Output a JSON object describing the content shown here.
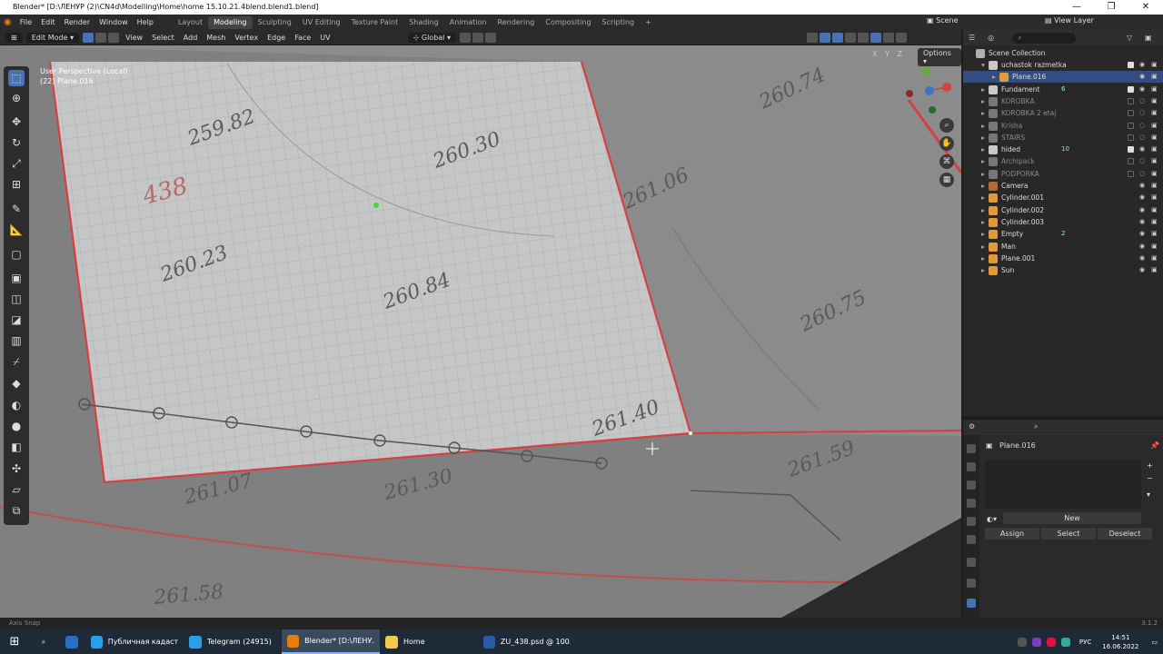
{
  "window": {
    "title": "Blender* [D:\\ЛЕНУР (2)\\CN4d\\Modelling\\Home\\home 15.10.21.4blend.blend1.blend]"
  },
  "menu": {
    "items": [
      "File",
      "Edit",
      "Render",
      "Window",
      "Help"
    ],
    "workspaces": [
      "Layout",
      "Modeling",
      "Sculpting",
      "UV Editing",
      "Texture Paint",
      "Shading",
      "Animation",
      "Rendering",
      "Compositing",
      "Scripting"
    ],
    "active_workspace": "Modeling",
    "add": "+",
    "scene": "Scene",
    "view_layer": "View Layer"
  },
  "header": {
    "mode": "Edit Mode",
    "items": [
      "View",
      "Select",
      "Add",
      "Mesh",
      "Vertex",
      "Edge",
      "Face",
      "UV"
    ],
    "orientation": "Global"
  },
  "viewport": {
    "view_name": "User Perspective (Local)",
    "object_info": "(22) Plane.016",
    "options": "Options",
    "axes": "X Y Z",
    "annotations": [
      "259.82",
      "260.30",
      "438",
      "261.06",
      "260.74",
      "260.23",
      "260.84",
      "260.75",
      "261.40",
      "261.59",
      "261.07",
      "261.30",
      "261.58"
    ]
  },
  "outliner": {
    "title": "Scene Collection",
    "search_placeholder": "",
    "rows": [
      {
        "label": "uchastok razmetka",
        "indent": 1,
        "expanded": true,
        "type": "collection",
        "check": true
      },
      {
        "label": "Plane.016",
        "indent": 2,
        "type": "mesh",
        "selected": true
      },
      {
        "label": "Fundament",
        "indent": 1,
        "type": "collection",
        "check": true,
        "extra": "6"
      },
      {
        "label": "KOROBKA",
        "indent": 1,
        "type": "collection",
        "dim": true
      },
      {
        "label": "KOROBKA 2 etaj",
        "indent": 1,
        "type": "collection",
        "dim": true
      },
      {
        "label": "Krisha",
        "indent": 1,
        "type": "collection",
        "dim": true
      },
      {
        "label": "STAIRS",
        "indent": 1,
        "type": "collection",
        "dim": true
      },
      {
        "label": "hided",
        "indent": 1,
        "type": "collection",
        "check": true,
        "extra": "10"
      },
      {
        "label": "Archipack",
        "indent": 1,
        "type": "collection",
        "dim": true
      },
      {
        "label": "PODPORKA",
        "indent": 1,
        "type": "collection",
        "dim": true
      },
      {
        "label": "Camera",
        "indent": 1,
        "type": "camera"
      },
      {
        "label": "Cylinder.001",
        "indent": 1,
        "type": "mesh"
      },
      {
        "label": "Cylinder.002",
        "indent": 1,
        "type": "mesh"
      },
      {
        "label": "Cylinder.003",
        "indent": 1,
        "type": "mesh"
      },
      {
        "label": "Empty",
        "indent": 1,
        "type": "empty",
        "extra": "2"
      },
      {
        "label": "Man",
        "indent": 1,
        "type": "mesh"
      },
      {
        "label": "Plane.001",
        "indent": 1,
        "type": "mesh"
      },
      {
        "label": "Sun",
        "indent": 1,
        "type": "light"
      }
    ]
  },
  "properties": {
    "object": "Plane.016",
    "new": "New",
    "assign": "Assign",
    "select": "Select",
    "deselect": "Deselect"
  },
  "status": {
    "hint": "Axis Snap",
    "version": "3.1.2"
  },
  "taskbar": {
    "apps": [
      {
        "label": "Публичная кадаст...",
        "color": "#2aa1e6"
      },
      {
        "label": "Telegram (24915)",
        "color": "#2aa1e6"
      },
      {
        "label": "Blender* [D:\\ЛЕНУ...",
        "color": "#e87d0d",
        "active": true
      },
      {
        "label": "Home",
        "color": "#f2c94c"
      },
      {
        "label": "ZU_438.psd @ 100...",
        "color": "#2b5aa6"
      }
    ],
    "lang": "РУС",
    "time": "14:51",
    "date": "16.06.2022"
  },
  "colors": {
    "accent": "#4772b3",
    "edge": "#d64040",
    "selection": "#334d80"
  }
}
